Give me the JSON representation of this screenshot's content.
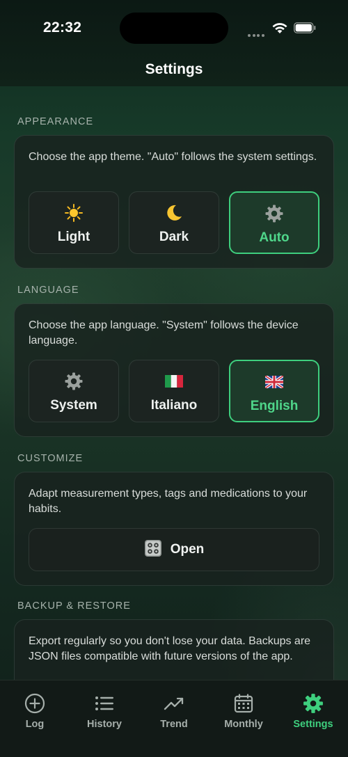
{
  "status": {
    "time": "22:32"
  },
  "header": {
    "title": "Settings"
  },
  "appearance": {
    "section_title": "APPEARANCE",
    "description": "Choose the app theme. \"Auto\" follows the system settings.",
    "options": [
      {
        "label": "Light",
        "icon": "sun-icon",
        "glyph": "☀️",
        "selected": false
      },
      {
        "label": "Dark",
        "icon": "moon-icon",
        "glyph": "🌙",
        "selected": false
      },
      {
        "label": "Auto",
        "icon": "gear-icon",
        "glyph": "⚙️",
        "selected": true
      }
    ]
  },
  "language": {
    "section_title": "LANGUAGE",
    "description": "Choose the app language. \"System\" follows the device language.",
    "options": [
      {
        "label": "System",
        "icon": "gear-icon",
        "glyph": "⚙️",
        "selected": false
      },
      {
        "label": "Italiano",
        "icon": "italy-flag-icon",
        "selected": false
      },
      {
        "label": "English",
        "icon": "uk-flag-icon",
        "selected": true
      }
    ]
  },
  "customize": {
    "section_title": "CUSTOMIZE",
    "description": "Adapt measurement types, tags and medications to your habits.",
    "open_label": "Open",
    "open_icon": "control-knobs-icon"
  },
  "backup": {
    "section_title": "BACKUP & RESTORE",
    "description": "Export regularly so you don't lose your data. Backups are JSON files compatible with future versions of the app."
  },
  "tabbar": {
    "items": [
      {
        "label": "Log",
        "icon": "plus-circle-icon",
        "active": false
      },
      {
        "label": "History",
        "icon": "list-icon",
        "active": false
      },
      {
        "label": "Trend",
        "icon": "trend-icon",
        "active": false
      },
      {
        "label": "Monthly",
        "icon": "calendar-icon",
        "active": false
      },
      {
        "label": "Settings",
        "icon": "gear-icon",
        "active": true
      }
    ]
  },
  "colors": {
    "accent": "#3ecf7e",
    "background": "#0f1a15",
    "card": "#18221e"
  }
}
